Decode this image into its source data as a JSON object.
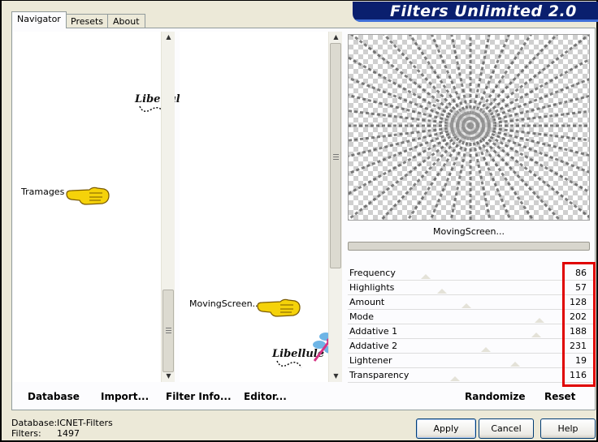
{
  "window": {
    "title": "Filters Unlimited 2.0"
  },
  "tabs": [
    {
      "label": "Navigator",
      "active": true
    },
    {
      "label": "Presets",
      "active": false
    },
    {
      "label": "About",
      "active": false
    }
  ],
  "category_list": {
    "selected": "Tramages"
  },
  "filter_list": {
    "selected": "MovingScreen..."
  },
  "watermark": {
    "text": "Libellule"
  },
  "preview": {
    "filter_name": "MovingScreen...",
    "progress": 0
  },
  "parameters": [
    {
      "name": "Frequency",
      "value": "86"
    },
    {
      "name": "Highlights",
      "value": "57"
    },
    {
      "name": "Amount",
      "value": "128"
    },
    {
      "name": "Mode",
      "value": "202"
    },
    {
      "name": "Addative 1",
      "value": "188"
    },
    {
      "name": "Addative 2",
      "value": "231"
    },
    {
      "name": "Lightener",
      "value": "19"
    },
    {
      "name": "Transparency",
      "value": "116"
    }
  ],
  "toolbar": {
    "database_label": "Database",
    "import_label": "Import...",
    "filter_info_label": "Filter Info...",
    "editor_label": "Editor...",
    "randomize_label": "Randomize",
    "reset_label": "Reset"
  },
  "status": {
    "database_label": "Database:",
    "database_value": "ICNET-Filters",
    "filters_label": "Filters:",
    "filters_value": "1497"
  },
  "buttons": {
    "apply": "Apply",
    "cancel": "Cancel",
    "help": "Help"
  },
  "colors": {
    "title_bg": "#0a1f6e",
    "highlight_frame": "#e00000",
    "pointer_hand": "#f5d20a",
    "dragonfly_wing": "#4aa3e0",
    "dragonfly_body": "#d63384"
  }
}
